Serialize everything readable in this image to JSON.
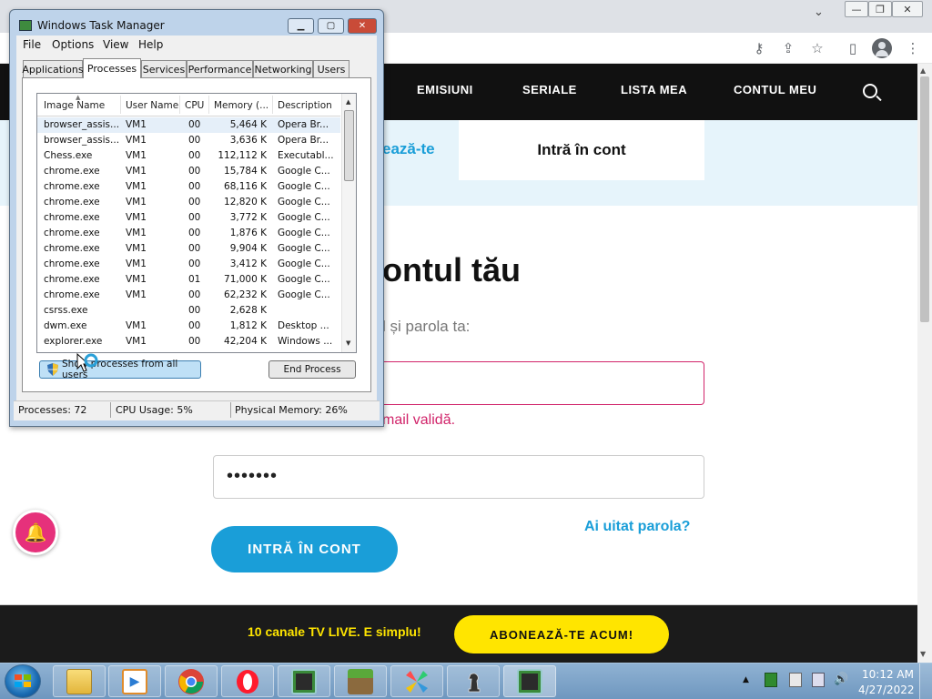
{
  "browser": {
    "window_controls": {
      "minimize": "—",
      "restore": "❐",
      "close": "✕"
    },
    "toolbar_icons": {
      "key": "⚷",
      "share": "⇪",
      "star": "☆",
      "sidebar": "▯",
      "menu": "⋮"
    }
  },
  "site": {
    "nav": [
      {
        "label": "EMISIUNI"
      },
      {
        "label": "SERIALE"
      },
      {
        "label": "LISTA MEA"
      },
      {
        "label": "CONTUL MEU"
      }
    ],
    "tabs": {
      "register": "ează-te",
      "login": "Intră în cont"
    },
    "heading": "ontul tău",
    "subheading": "l și parola ta:",
    "email_error": "mail validă.",
    "password_value": "•••••••",
    "forgot_password": "Ai uitat parola?",
    "login_button": "INTRĂ ÎN CONT",
    "promo": {
      "text": "10 canale TV LIVE. E simplu!",
      "button": "ABONEAZĂ-TE ACUM!"
    },
    "colors": {
      "accent": "#1a9ed8",
      "error": "#d1246a",
      "promo": "#ffe500",
      "nav_bg": "#111111"
    }
  },
  "task_manager": {
    "title": "Windows Task Manager",
    "menu": [
      "File",
      "Options",
      "View",
      "Help"
    ],
    "tabs": [
      "Applications",
      "Processes",
      "Services",
      "Performance",
      "Networking",
      "Users"
    ],
    "active_tab": "Processes",
    "columns": [
      "Image Name",
      "User Name",
      "CPU",
      "Memory (...",
      "Description"
    ],
    "processes": [
      {
        "name": "browser_assis...",
        "user": "VM1",
        "cpu": "00",
        "memory": "5,464 K",
        "desc": "Opera Br..."
      },
      {
        "name": "browser_assis...",
        "user": "VM1",
        "cpu": "00",
        "memory": "3,636 K",
        "desc": "Opera Br..."
      },
      {
        "name": "Chess.exe",
        "user": "VM1",
        "cpu": "00",
        "memory": "112,112 K",
        "desc": "Executabl..."
      },
      {
        "name": "chrome.exe",
        "user": "VM1",
        "cpu": "00",
        "memory": "15,784 K",
        "desc": "Google C..."
      },
      {
        "name": "chrome.exe",
        "user": "VM1",
        "cpu": "00",
        "memory": "68,116 K",
        "desc": "Google C..."
      },
      {
        "name": "chrome.exe",
        "user": "VM1",
        "cpu": "00",
        "memory": "12,820 K",
        "desc": "Google C..."
      },
      {
        "name": "chrome.exe",
        "user": "VM1",
        "cpu": "00",
        "memory": "3,772 K",
        "desc": "Google C..."
      },
      {
        "name": "chrome.exe",
        "user": "VM1",
        "cpu": "00",
        "memory": "1,876 K",
        "desc": "Google C..."
      },
      {
        "name": "chrome.exe",
        "user": "VM1",
        "cpu": "00",
        "memory": "9,904 K",
        "desc": "Google C..."
      },
      {
        "name": "chrome.exe",
        "user": "VM1",
        "cpu": "00",
        "memory": "3,412 K",
        "desc": "Google C..."
      },
      {
        "name": "chrome.exe",
        "user": "VM1",
        "cpu": "01",
        "memory": "71,000 K",
        "desc": "Google C..."
      },
      {
        "name": "chrome.exe",
        "user": "VM1",
        "cpu": "00",
        "memory": "62,232 K",
        "desc": "Google C..."
      },
      {
        "name": "csrss.exe",
        "user": "",
        "cpu": "00",
        "memory": "2,628 K",
        "desc": ""
      },
      {
        "name": "dwm.exe",
        "user": "VM1",
        "cpu": "00",
        "memory": "1,812 K",
        "desc": "Desktop ..."
      },
      {
        "name": "explorer.exe",
        "user": "VM1",
        "cpu": "00",
        "memory": "42,204 K",
        "desc": "Windows ..."
      }
    ],
    "show_all_button": "Show processes from all users",
    "end_process_button": "End Process",
    "status": {
      "processes": "Processes: 72",
      "cpu": "CPU Usage: 5%",
      "memory": "Physical Memory: 26%"
    }
  },
  "taskbar": {
    "apps": [
      "explorer-icon",
      "media-player-icon",
      "chrome-icon",
      "opera-icon",
      "task-manager-icon",
      "minecraft-icon",
      "game-icon",
      "chess-icon",
      "task-manager-icon"
    ],
    "time": "10:12 AM",
    "date": "4/27/2022"
  }
}
